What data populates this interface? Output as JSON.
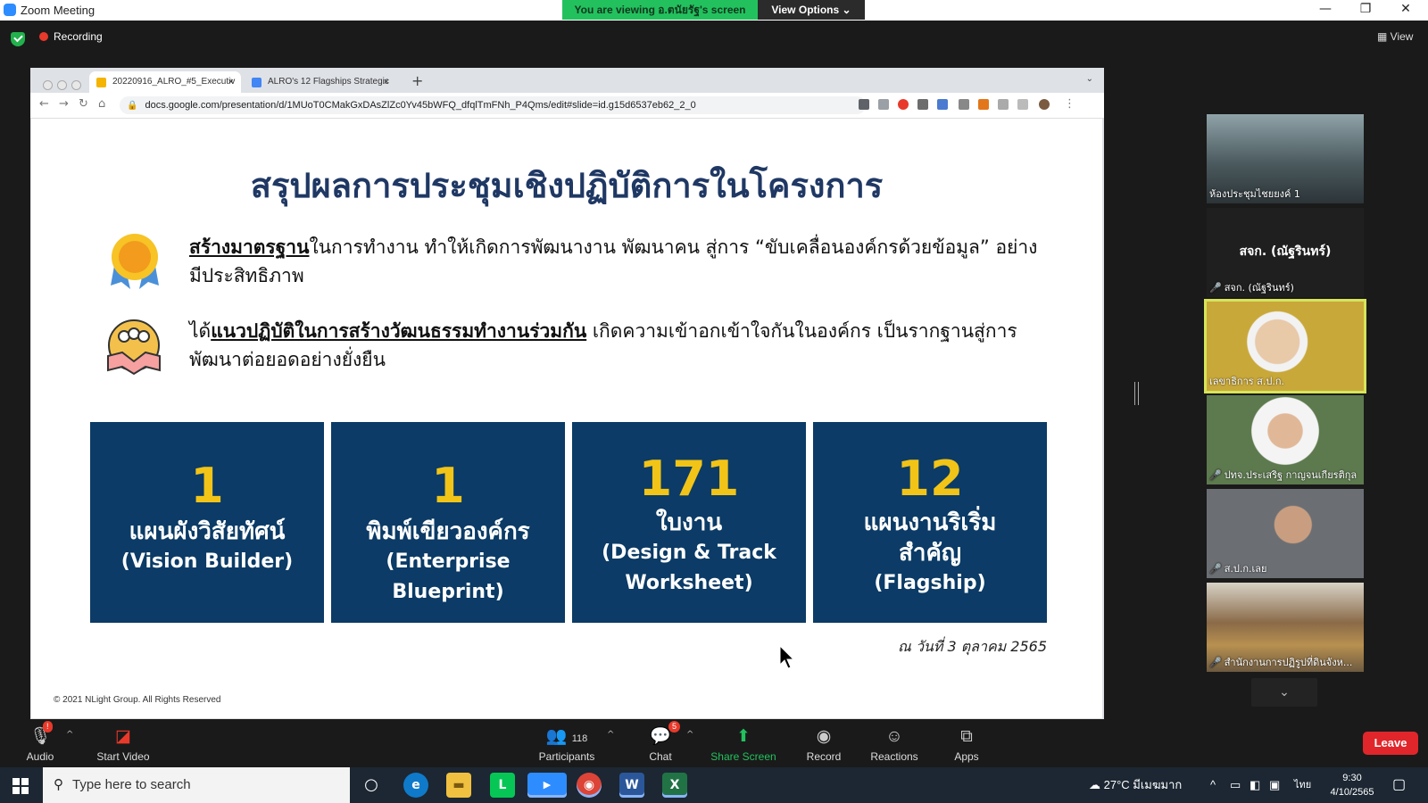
{
  "window": {
    "title": "Zoom Meeting",
    "viewing_banner": "You are viewing อ.ตนัยรัฐ's screen",
    "view_options": "View Options",
    "minimize": "—",
    "maximize": "❐",
    "close": "✕"
  },
  "topbar": {
    "recording": "Recording",
    "view": "View"
  },
  "browser": {
    "tabs": [
      {
        "label": "20220916_ALRO_#5_Executiv",
        "icon_color": "#f4b400"
      },
      {
        "label": "ALRO's 12 Flagships Strategic",
        "icon_color": "#4285f4"
      }
    ],
    "tab_close": "×",
    "new_tab": "+",
    "tab_menu": "⌄",
    "url": "docs.google.com/presentation/d/1MUoT0CMakGxDAsZlZc0Yv45bWFQ_dfqlTmFNh_P4Qms/edit#slide=id.g15d6537eb62_2_0"
  },
  "slide": {
    "title": "สรุปผลการประชุมเชิงปฏิบัติการในโครงการ",
    "bullet1_em": "สร้างมาตรฐาน",
    "bullet1_rest": "ในการทำงาน ทำให้เกิดการพัฒนางาน พัฒนาคน สู่การ “ขับเคลื่อนองค์กรด้วยข้อมูล” อย่างมีประสิทธิภาพ",
    "bullet2_pre": "ได้",
    "bullet2_em": "แนวปฏิบัติในการสร้างวัฒนธรรมทำงานร่วมกัน",
    "bullet2_rest": " เกิดความเข้าอกเข้าใจกันในองค์กร เป็นรากฐานสู่การพัฒนาต่อยอดอย่างยั่งยืน",
    "boxes": [
      {
        "num": "1",
        "label": "แผนผังวิสัยทัศน์",
        "sub": "(Vision Builder)"
      },
      {
        "num": "1",
        "label": "พิมพ์เขียวองค์กร",
        "sub": "(Enterprise Blueprint)"
      },
      {
        "num": "171",
        "label": "ใบงาน",
        "sub": "(Design & Track Worksheet)"
      },
      {
        "num": "12",
        "label": "แผนงานริเริ่มสำคัญ",
        "sub": "(Flagship)"
      }
    ],
    "date": "ณ วันที่ 3 ตุลาคม 2565",
    "copyright": "© 2021 NLight Group. All Rights Reserved"
  },
  "gallery": {
    "tiles": [
      {
        "name": "ห้องประชุมไชยยงค์ 1",
        "muted": false,
        "bg": "#5a6a70"
      },
      {
        "name": "สจก. (ณัฐรินทร์)",
        "big": "สจก. (ณัฐรินทร์)",
        "muted": true,
        "bg": "#222222"
      },
      {
        "name": "เลขาธิการ ส.ป.ก.",
        "muted": false,
        "bg": "#c9a83a"
      },
      {
        "name": "ปทจ.ประเสริฐ กาญจนเกียรติกุล",
        "muted": true,
        "bg": "#5d7a4f"
      },
      {
        "name": "ส.ป.ก.เลย",
        "muted": true,
        "bg": "#6b6f74"
      },
      {
        "name": "สำนักงานการปฏิรูปที่ดินจังห...",
        "muted": true,
        "bg": "#8a6a48"
      }
    ],
    "scroll_down": "⌄"
  },
  "controls": {
    "audio": "Audio",
    "audio_badge": "!",
    "start_video": "Start Video",
    "participants": "Participants",
    "participants_count": "118",
    "chat": "Chat",
    "chat_badge": "5",
    "share_screen": "Share Screen",
    "record": "Record",
    "reactions": "Reactions",
    "apps": "Apps",
    "leave": "Leave"
  },
  "taskbar": {
    "search_placeholder": "Type here to search",
    "weather": "27°C มีเมฆมาก",
    "lang": "ไทย",
    "time": "9:30",
    "date": "4/10/2565",
    "apps": [
      {
        "name": "cortana",
        "glyph": "○",
        "color": "transparent"
      },
      {
        "name": "edge",
        "glyph": "e",
        "color": "#0f7ac9"
      },
      {
        "name": "file-explorer",
        "glyph": "▬",
        "color": "#f0c040"
      },
      {
        "name": "line",
        "glyph": "L",
        "color": "#06c755"
      },
      {
        "name": "zoom",
        "glyph": "▶",
        "color": "#2d8cff"
      },
      {
        "name": "chrome",
        "glyph": "◉",
        "color": "#db4437"
      },
      {
        "name": "word",
        "glyph": "W",
        "color": "#2b579a"
      },
      {
        "name": "excel",
        "glyph": "X",
        "color": "#217346"
      }
    ]
  }
}
